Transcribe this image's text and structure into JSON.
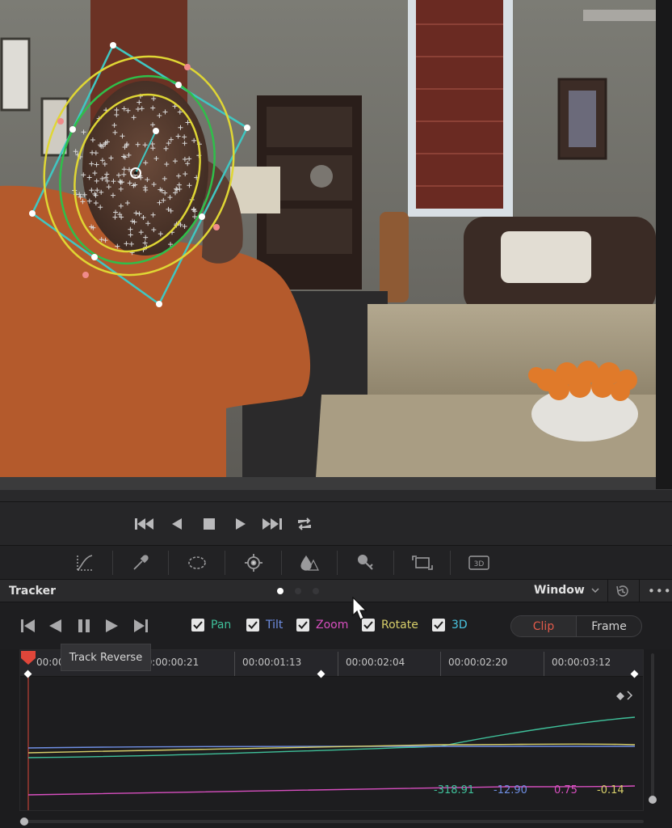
{
  "panel": {
    "title": "Tracker",
    "mode_select": "Window",
    "more_label": "•••",
    "page_dots": [
      "active",
      "inactive",
      "inactive"
    ]
  },
  "tracking": {
    "tooltip": "Track Reverse",
    "options": [
      {
        "label": "Pan",
        "checked": true,
        "color": "#3fc09a"
      },
      {
        "label": "Tilt",
        "checked": true,
        "color": "#6f8fe4"
      },
      {
        "label": "Zoom",
        "checked": true,
        "color": "#d84fc0"
      },
      {
        "label": "Rotate",
        "checked": true,
        "color": "#d8cf6a"
      },
      {
        "label": "3D",
        "checked": true,
        "color": "#49c6e2"
      }
    ],
    "segment": {
      "clip": "Clip",
      "frame": "Frame",
      "selected": "clip"
    }
  },
  "timeline": {
    "ticks": [
      "00:00:00:00",
      "00:00:00:21",
      "00:00:01:13",
      "00:00:02:04",
      "00:00:02:20",
      "00:00:03:12"
    ],
    "tick_first_visible": "00:00:0",
    "readouts": [
      {
        "value": "-318.91",
        "color": "#3fc09a"
      },
      {
        "value": "-12.90",
        "color": "#6f8fe4"
      },
      {
        "value": "0.75",
        "color": "#d84fc0"
      },
      {
        "value": "-0.14",
        "color": "#d8cf6a"
      }
    ],
    "playhead_color": "#e0463a"
  },
  "icons": {
    "transport": [
      "skip-to-start-icon",
      "play-reverse-icon",
      "stop-icon",
      "play-icon",
      "skip-to-end-icon",
      "loop-icon"
    ],
    "tools": [
      "curves-icon",
      "eyedropper-icon",
      "window-icon",
      "tracker-icon",
      "blur-icon",
      "key-icon",
      "sizing-icon",
      "3d-icon"
    ],
    "tracker": [
      "track-step-back-icon",
      "track-reverse-icon",
      "pause-icon",
      "track-forward-icon",
      "track-step-forward-icon"
    ]
  },
  "tool_3d_label": "3D"
}
